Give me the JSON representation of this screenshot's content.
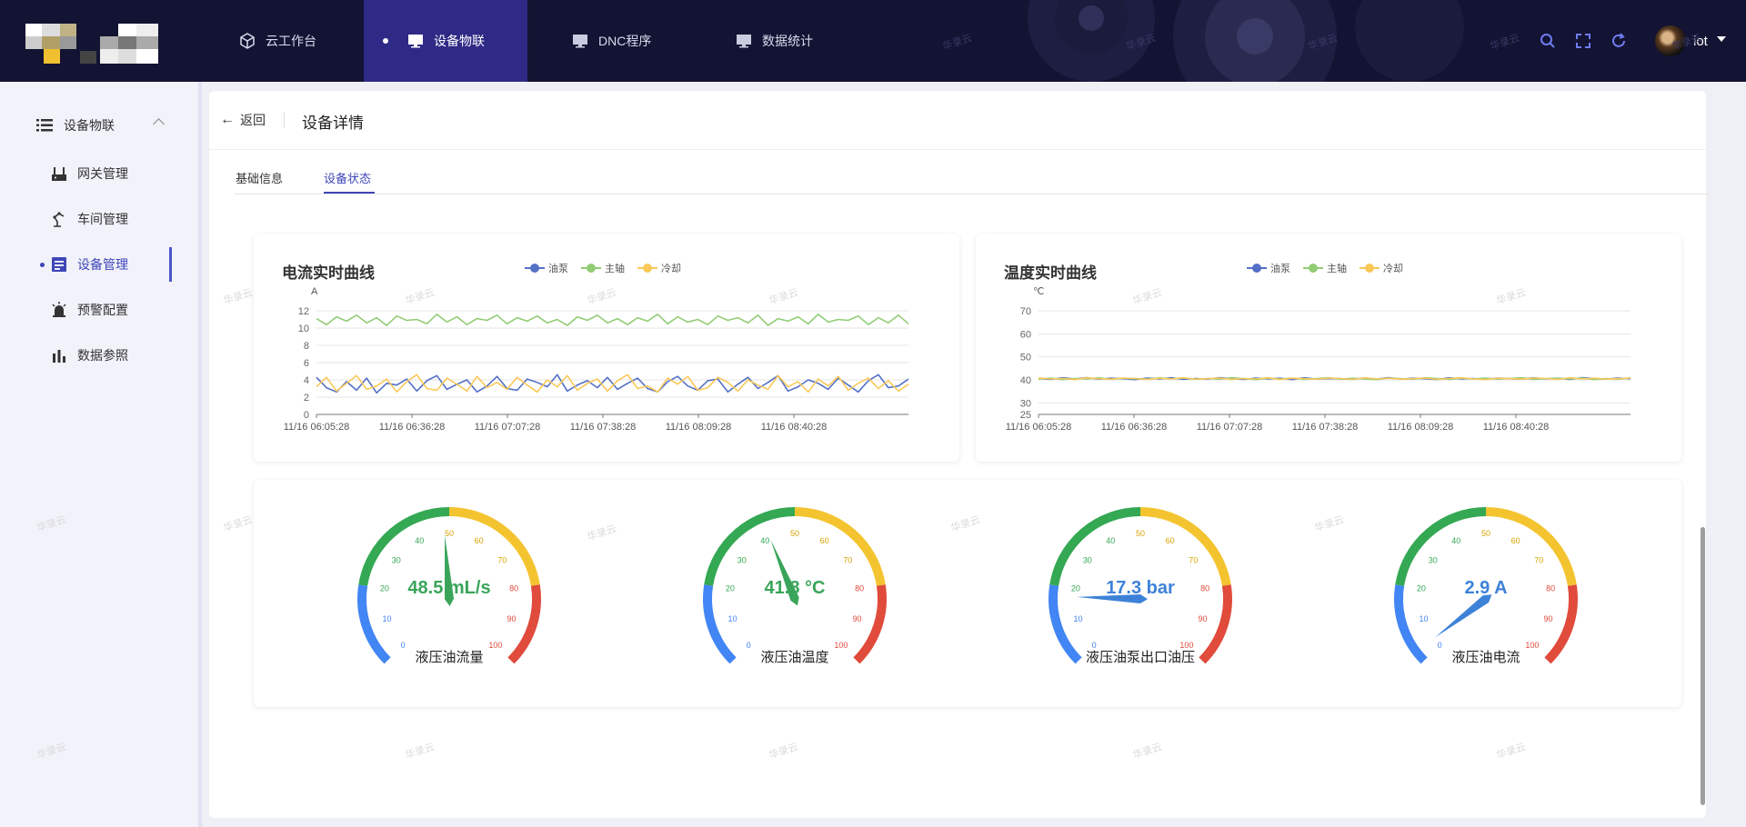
{
  "topbar": {
    "nav": [
      {
        "label": "云工作台",
        "icon": "cube-icon"
      },
      {
        "label": "设备物联",
        "icon": "monitor-icon",
        "active": true
      },
      {
        "label": "DNC程序",
        "icon": "monitor-icon"
      },
      {
        "label": "数据统计",
        "icon": "monitor-icon"
      }
    ],
    "tools": [
      "search-icon",
      "fullscreen-icon",
      "refresh-icon"
    ],
    "user": "iot",
    "watermark": "华录云"
  },
  "sidebar": {
    "group": "设备物联",
    "items": [
      {
        "label": "网关管理",
        "icon": "gateway-icon"
      },
      {
        "label": "车间管理",
        "icon": "robot-arm-icon"
      },
      {
        "label": "设备管理",
        "icon": "device-icon",
        "active": true
      },
      {
        "label": "预警配置",
        "icon": "alarm-icon"
      },
      {
        "label": "数据参照",
        "icon": "bar-chart-icon"
      }
    ]
  },
  "header": {
    "back": "返回",
    "title": "设备详情"
  },
  "tabs": [
    {
      "label": "基础信息"
    },
    {
      "label": "设备状态",
      "active": true
    }
  ],
  "colors": {
    "accent": "#3f46b8",
    "series": [
      "#5470c6",
      "#91cc75",
      "#fac858"
    ]
  },
  "chart_data": [
    {
      "type": "line",
      "title": "电流实时曲线",
      "ylabel": "A",
      "ylim": [
        0,
        12
      ],
      "yticks": [
        0,
        2,
        4,
        6,
        8,
        10,
        12
      ],
      "xticks": [
        "11/16 06:05:28",
        "11/16 06:36:28",
        "11/16 07:07:28",
        "11/16 07:38:28",
        "11/16 08:09:28",
        "11/16 08:40:28"
      ],
      "legend_position": "top",
      "series": [
        {
          "name": "油泵",
          "values": [
            4.3,
            3.1,
            2.6,
            3.8,
            2.8,
            4.2,
            2.5,
            3.6,
            3.4,
            4.1,
            2.7,
            3.9,
            4.5,
            2.9,
            3.5,
            4.0,
            2.6,
            3.3,
            4.4,
            3.0,
            2.8,
            4.1,
            3.7,
            3.2,
            4.6,
            2.7,
            3.4,
            3.9,
            3.1,
            4.3,
            2.9,
            3.6,
            4.2,
            3.0,
            2.6,
            3.8,
            4.4,
            3.3,
            2.8,
            3.9,
            4.1,
            2.6,
            3.5,
            4.3,
            3.0,
            3.7,
            4.5,
            2.7,
            3.2,
            4.0,
            3.6,
            2.9,
            4.2,
            3.4,
            2.6,
            3.9,
            4.6,
            3.1,
            3.3,
            4.1
          ]
        },
        {
          "name": "主轴",
          "values": [
            11.1,
            10.4,
            11.3,
            10.8,
            11.5,
            10.6,
            11.2,
            10.3,
            11.4,
            10.9,
            11.0,
            10.5,
            11.6,
            10.7,
            11.3,
            10.4,
            11.1,
            10.9,
            11.5,
            10.5,
            11.2,
            10.8,
            11.4,
            10.6,
            11.0,
            10.3,
            11.3,
            10.9,
            11.5,
            10.6,
            11.1,
            10.4,
            11.2,
            10.8,
            11.6,
            10.5,
            11.3,
            10.7,
            11.0,
            10.4,
            11.4,
            10.9,
            11.2,
            10.6,
            11.5,
            10.3,
            11.1,
            10.8,
            11.3,
            10.5,
            11.6,
            10.7,
            11.0,
            10.9,
            11.4,
            10.4,
            11.2,
            10.6,
            11.5,
            10.5
          ]
        },
        {
          "name": "冷却",
          "values": [
            3.2,
            4.3,
            2.7,
            3.6,
            4.5,
            2.9,
            3.3,
            4.1,
            2.6,
            3.8,
            4.6,
            3.0,
            2.8,
            4.2,
            3.5,
            2.7,
            4.4,
            3.1,
            3.7,
            2.9,
            4.3,
            3.4,
            2.6,
            4.0,
            3.2,
            4.5,
            2.8,
            3.6,
            4.1,
            2.7,
            3.9,
            4.6,
            3.0,
            3.3,
            2.6,
            4.2,
            3.5,
            4.4,
            2.8,
            3.1,
            4.3,
            3.7,
            2.7,
            4.0,
            3.4,
            2.9,
            4.5,
            3.2,
            3.8,
            2.6,
            4.1,
            3.3,
            4.4,
            2.8,
            3.6,
            4.2,
            3.0,
            3.9,
            2.7,
            3.5
          ]
        }
      ]
    },
    {
      "type": "line",
      "title": "温度实时曲线",
      "ylabel": "℃",
      "ylim": [
        25,
        70
      ],
      "yticks": [
        25,
        30,
        40,
        50,
        60,
        70
      ],
      "xticks": [
        "11/16 06:05:28",
        "11/16 06:36:28",
        "11/16 07:07:28",
        "11/16 07:38:28",
        "11/16 08:09:28",
        "11/16 08:40:28"
      ],
      "legend_position": "top",
      "series": [
        {
          "name": "油泵",
          "values": [
            40.6,
            40.2,
            40.9,
            40.4,
            41.0,
            40.3,
            40.7,
            40.5,
            40.1,
            40.8,
            40.4,
            40.9,
            40.2,
            40.6,
            40.3,
            41.0,
            40.5,
            40.2,
            40.8,
            40.4,
            40.7,
            40.1,
            40.9,
            40.3,
            40.6,
            40.5,
            40.2,
            40.8,
            40.4,
            41.0,
            40.3,
            40.7,
            40.5,
            40.1,
            40.9,
            40.4,
            40.6,
            40.2,
            40.8,
            40.5,
            40.3,
            40.9,
            40.4,
            40.7,
            40.2,
            41.0,
            40.6,
            40.3,
            40.8,
            40.5
          ]
        },
        {
          "name": "主轴",
          "values": [
            40.3,
            40.8,
            40.1,
            40.6,
            40.4,
            40.9,
            40.2,
            40.7,
            40.5,
            40.3,
            40.9,
            40.4,
            40.8,
            40.2,
            40.6,
            40.3,
            40.9,
            40.5,
            40.1,
            40.7,
            40.4,
            40.8,
            40.2,
            40.6,
            40.9,
            40.3,
            40.7,
            40.4,
            40.1,
            40.8,
            40.5,
            40.3,
            40.9,
            40.6,
            40.2,
            40.7,
            40.4,
            40.8,
            40.3,
            40.6,
            40.9,
            40.2,
            40.5,
            40.7,
            40.4,
            40.8,
            40.1,
            40.6,
            40.3,
            40.9
          ]
        },
        {
          "name": "冷却",
          "values": [
            40.8,
            40.4,
            40.6,
            40.1,
            40.9,
            40.5,
            40.3,
            40.8,
            40.6,
            40.2,
            40.7,
            40.4,
            40.9,
            40.3,
            40.5,
            40.8,
            40.2,
            40.6,
            40.4,
            40.9,
            40.1,
            40.7,
            40.5,
            40.3,
            40.8,
            40.6,
            40.2,
            40.9,
            40.4,
            40.7,
            40.3,
            40.5,
            40.8,
            40.2,
            40.6,
            40.9,
            40.4,
            40.1,
            40.7,
            40.5,
            40.3,
            40.8,
            40.6,
            40.2,
            40.9,
            40.4,
            40.7,
            40.3,
            40.5,
            40.8
          ]
        }
      ]
    },
    {
      "type": "gauge",
      "name": "液压油流量",
      "display": "48.5 mL/s",
      "value": 48.5,
      "min": 0,
      "max": 100,
      "ticks": [
        0,
        10,
        20,
        30,
        40,
        50,
        60,
        70,
        80,
        90,
        100
      ],
      "value_color": "#3aa55a"
    },
    {
      "type": "gauge",
      "name": "液压油温度",
      "display": "41.8 °C",
      "value": 41.8,
      "min": 0,
      "max": 100,
      "ticks": [
        0,
        10,
        20,
        30,
        40,
        50,
        60,
        70,
        80,
        90,
        100
      ],
      "value_color": "#3aa55a"
    },
    {
      "type": "gauge",
      "name": "液压油泵出口油压",
      "display": "17.3 bar",
      "value": 17.3,
      "min": 0,
      "max": 100,
      "ticks": [
        0,
        10,
        20,
        30,
        40,
        50,
        60,
        70,
        80,
        90,
        100
      ],
      "value_color": "#3d82d8"
    },
    {
      "type": "gauge",
      "name": "液压油电流",
      "display": "2.9 A",
      "value": 2.9,
      "min": 0,
      "max": 100,
      "ticks": [
        0,
        10,
        20,
        30,
        40,
        50,
        60,
        70,
        80,
        90,
        100
      ],
      "value_color": "#3d82d8"
    }
  ]
}
